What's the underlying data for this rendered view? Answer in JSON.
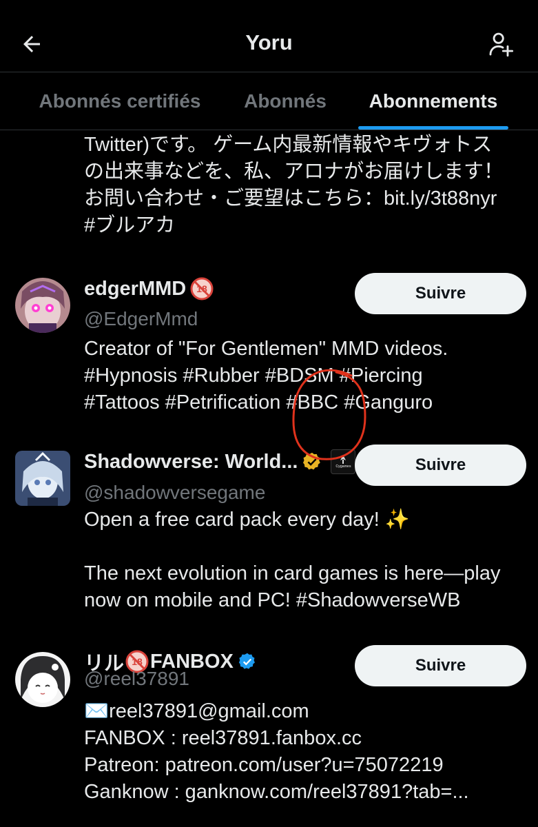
{
  "header": {
    "title": "Yoru"
  },
  "tabs": [
    {
      "label": "Abonnés certifiés",
      "active": false
    },
    {
      "label": "Abonnés",
      "active": false
    },
    {
      "label": "Abonnements",
      "active": true
    }
  ],
  "colors": {
    "background": "#000000",
    "accent": "#1d9bf0",
    "secondary_text": "#71767b",
    "annotation_circle": "#e0321c",
    "verified_blue": "#1d9bf0",
    "verified_gold": "#e8b324"
  },
  "partial_bio": {
    "line1": "Twitter)です。 ゲーム内最新情報やキヴォトス",
    "line2": "の出来事などを、私、アロナがお届けします！",
    "line3": "お問い合わせ・ご要望はこちら：bit.ly/3t88nyr",
    "line4": "#ブルアカ"
  },
  "users": [
    {
      "name": "edgerMMD",
      "badge": "18-restricted-icon",
      "handle": "@EdgerMmd",
      "follow_label": "Suivre",
      "bio_lines": [
        "Creator of \"For Gentlemen\" MMD videos.",
        "#Hypnosis #Rubber #BDSM #Piercing",
        "#Tattoos #Petrification #BBC #Ganguro"
      ]
    },
    {
      "name": "Shadowverse: World...",
      "badge": "gold-verified-icon",
      "affiliate_label": "Cygames",
      "handle": "@shadowversegame",
      "follow_label": "Suivre",
      "bio_lines": [
        "Open a free card pack every day! ✨",
        "",
        "The next evolution in card games is here—play",
        "now on mobile and PC! #ShadowverseWB"
      ]
    },
    {
      "name_prefix": "リル",
      "name_suffix": "FANBOX",
      "badge": "18-restricted-icon",
      "handle": "@reel37891",
      "follow_label": "Suivre",
      "bio_lines": [
        "✉️reel37891@gmail.com",
        "FANBOX : reel37891.fanbox.cc",
        "Patreon: patreon.com/user?u=75072219",
        "Ganknow : ganknow.com/reel37891?tab=..."
      ]
    }
  ]
}
